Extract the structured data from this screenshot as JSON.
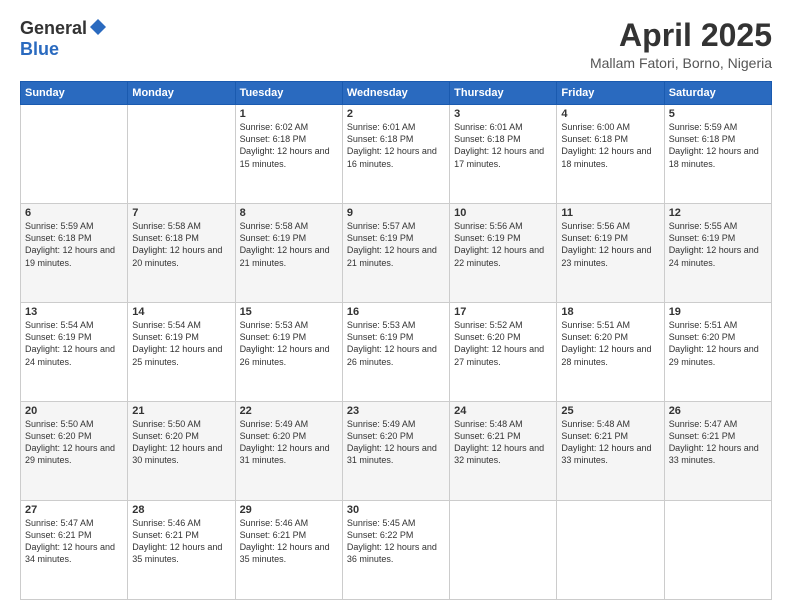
{
  "header": {
    "logo_general": "General",
    "logo_blue": "Blue",
    "month_title": "April 2025",
    "location": "Mallam Fatori, Borno, Nigeria"
  },
  "days_of_week": [
    "Sunday",
    "Monday",
    "Tuesday",
    "Wednesday",
    "Thursday",
    "Friday",
    "Saturday"
  ],
  "weeks": [
    [
      {
        "day": "",
        "info": ""
      },
      {
        "day": "",
        "info": ""
      },
      {
        "day": "1",
        "info": "Sunrise: 6:02 AM\nSunset: 6:18 PM\nDaylight: 12 hours and 15 minutes."
      },
      {
        "day": "2",
        "info": "Sunrise: 6:01 AM\nSunset: 6:18 PM\nDaylight: 12 hours and 16 minutes."
      },
      {
        "day": "3",
        "info": "Sunrise: 6:01 AM\nSunset: 6:18 PM\nDaylight: 12 hours and 17 minutes."
      },
      {
        "day": "4",
        "info": "Sunrise: 6:00 AM\nSunset: 6:18 PM\nDaylight: 12 hours and 18 minutes."
      },
      {
        "day": "5",
        "info": "Sunrise: 5:59 AM\nSunset: 6:18 PM\nDaylight: 12 hours and 18 minutes."
      }
    ],
    [
      {
        "day": "6",
        "info": "Sunrise: 5:59 AM\nSunset: 6:18 PM\nDaylight: 12 hours and 19 minutes."
      },
      {
        "day": "7",
        "info": "Sunrise: 5:58 AM\nSunset: 6:18 PM\nDaylight: 12 hours and 20 minutes."
      },
      {
        "day": "8",
        "info": "Sunrise: 5:58 AM\nSunset: 6:19 PM\nDaylight: 12 hours and 21 minutes."
      },
      {
        "day": "9",
        "info": "Sunrise: 5:57 AM\nSunset: 6:19 PM\nDaylight: 12 hours and 21 minutes."
      },
      {
        "day": "10",
        "info": "Sunrise: 5:56 AM\nSunset: 6:19 PM\nDaylight: 12 hours and 22 minutes."
      },
      {
        "day": "11",
        "info": "Sunrise: 5:56 AM\nSunset: 6:19 PM\nDaylight: 12 hours and 23 minutes."
      },
      {
        "day": "12",
        "info": "Sunrise: 5:55 AM\nSunset: 6:19 PM\nDaylight: 12 hours and 24 minutes."
      }
    ],
    [
      {
        "day": "13",
        "info": "Sunrise: 5:54 AM\nSunset: 6:19 PM\nDaylight: 12 hours and 24 minutes."
      },
      {
        "day": "14",
        "info": "Sunrise: 5:54 AM\nSunset: 6:19 PM\nDaylight: 12 hours and 25 minutes."
      },
      {
        "day": "15",
        "info": "Sunrise: 5:53 AM\nSunset: 6:19 PM\nDaylight: 12 hours and 26 minutes."
      },
      {
        "day": "16",
        "info": "Sunrise: 5:53 AM\nSunset: 6:19 PM\nDaylight: 12 hours and 26 minutes."
      },
      {
        "day": "17",
        "info": "Sunrise: 5:52 AM\nSunset: 6:20 PM\nDaylight: 12 hours and 27 minutes."
      },
      {
        "day": "18",
        "info": "Sunrise: 5:51 AM\nSunset: 6:20 PM\nDaylight: 12 hours and 28 minutes."
      },
      {
        "day": "19",
        "info": "Sunrise: 5:51 AM\nSunset: 6:20 PM\nDaylight: 12 hours and 29 minutes."
      }
    ],
    [
      {
        "day": "20",
        "info": "Sunrise: 5:50 AM\nSunset: 6:20 PM\nDaylight: 12 hours and 29 minutes."
      },
      {
        "day": "21",
        "info": "Sunrise: 5:50 AM\nSunset: 6:20 PM\nDaylight: 12 hours and 30 minutes."
      },
      {
        "day": "22",
        "info": "Sunrise: 5:49 AM\nSunset: 6:20 PM\nDaylight: 12 hours and 31 minutes."
      },
      {
        "day": "23",
        "info": "Sunrise: 5:49 AM\nSunset: 6:20 PM\nDaylight: 12 hours and 31 minutes."
      },
      {
        "day": "24",
        "info": "Sunrise: 5:48 AM\nSunset: 6:21 PM\nDaylight: 12 hours and 32 minutes."
      },
      {
        "day": "25",
        "info": "Sunrise: 5:48 AM\nSunset: 6:21 PM\nDaylight: 12 hours and 33 minutes."
      },
      {
        "day": "26",
        "info": "Sunrise: 5:47 AM\nSunset: 6:21 PM\nDaylight: 12 hours and 33 minutes."
      }
    ],
    [
      {
        "day": "27",
        "info": "Sunrise: 5:47 AM\nSunset: 6:21 PM\nDaylight: 12 hours and 34 minutes."
      },
      {
        "day": "28",
        "info": "Sunrise: 5:46 AM\nSunset: 6:21 PM\nDaylight: 12 hours and 35 minutes."
      },
      {
        "day": "29",
        "info": "Sunrise: 5:46 AM\nSunset: 6:21 PM\nDaylight: 12 hours and 35 minutes."
      },
      {
        "day": "30",
        "info": "Sunrise: 5:45 AM\nSunset: 6:22 PM\nDaylight: 12 hours and 36 minutes."
      },
      {
        "day": "",
        "info": ""
      },
      {
        "day": "",
        "info": ""
      },
      {
        "day": "",
        "info": ""
      }
    ]
  ]
}
